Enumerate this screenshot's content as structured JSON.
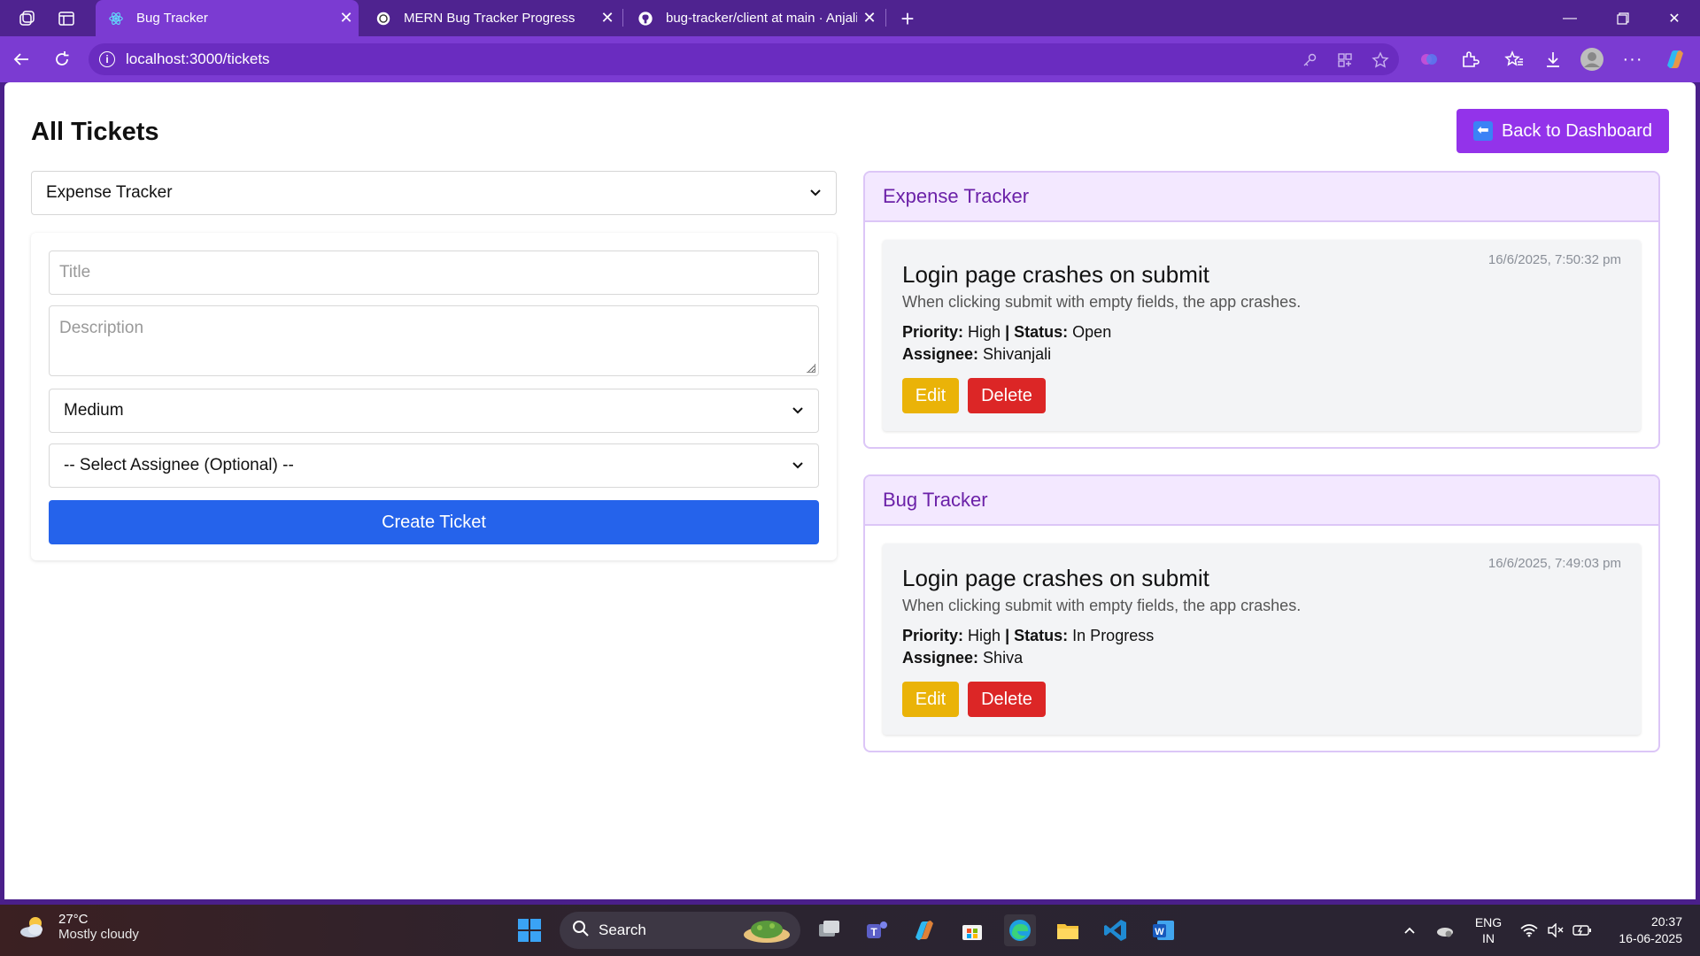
{
  "browser": {
    "tabs": [
      {
        "title": "Bug Tracker",
        "active": true
      },
      {
        "title": "MERN Bug Tracker Progress",
        "active": false
      },
      {
        "title": "bug-tracker/client at main · Anjali",
        "active": false
      }
    ],
    "url": "localhost:3000/tickets"
  },
  "page": {
    "title": "All Tickets",
    "back_button": "Back to Dashboard",
    "project_select": "Expense Tracker",
    "form": {
      "title_placeholder": "Title",
      "description_placeholder": "Description",
      "priority": "Medium",
      "assignee": "-- Select Assignee (Optional) --",
      "create_button": "Create Ticket"
    },
    "projects": [
      {
        "name": "Expense Tracker",
        "tickets": [
          {
            "date": "16/6/2025, 7:50:32 pm",
            "title": "Login page crashes on submit",
            "description": "When clicking submit with empty fields, the app crashes.",
            "priority_label": "Priority:",
            "priority": "High",
            "separator": "|",
            "status_label": "Status:",
            "status": "Open",
            "assignee_label": "Assignee:",
            "assignee": "Shivanjali",
            "edit": "Edit",
            "delete": "Delete"
          }
        ]
      },
      {
        "name": "Bug Tracker",
        "tickets": [
          {
            "date": "16/6/2025, 7:49:03 pm",
            "title": "Login page crashes on submit",
            "description": "When clicking submit with empty fields, the app crashes.",
            "priority_label": "Priority:",
            "priority": "High",
            "separator": "|",
            "status_label": "Status:",
            "status": "In Progress",
            "assignee_label": "Assignee:",
            "assignee": "Shiva",
            "edit": "Edit",
            "delete": "Delete"
          }
        ]
      }
    ]
  },
  "taskbar": {
    "weather_temp": "27°C",
    "weather_desc": "Mostly cloudy",
    "search_label": "Search",
    "lang_1": "ENG",
    "lang_2": "IN",
    "time": "20:37",
    "date": "16-06-2025"
  },
  "colors": {
    "accent_purple": "#9333ea",
    "primary_blue": "#2563eb",
    "edit_yellow": "#eab308",
    "delete_red": "#dc2626",
    "project_header_bg": "#f3e8ff",
    "project_header_text": "#6b21a8"
  }
}
